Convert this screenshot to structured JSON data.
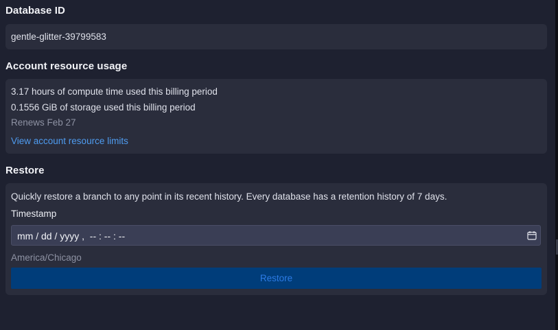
{
  "database": {
    "heading": "Database ID",
    "id": "gentle-glitter-39799583"
  },
  "usage": {
    "heading": "Account resource usage",
    "compute": "3.17 hours of compute time used this billing period",
    "storage": "0.1556 GiB of storage used this billing period",
    "renews": "Renews Feb 27",
    "limits_link": "View account resource limits"
  },
  "restore": {
    "heading": "Restore",
    "description": "Quickly restore a branch to any point in its recent history. Every database has a retention history of 7 days.",
    "timestamp_label": "Timestamp",
    "timestamp_value": "mm / dd / yyyy ,  -- : -- : --",
    "timezone": "America/Chicago",
    "button_label": "Restore",
    "calendar_icon": "calendar-icon"
  },
  "colors": {
    "background": "#1e2130",
    "card": "#2a2d3c",
    "input": "#3a3e55",
    "link": "#4f9cf0",
    "button_bg": "#003d7a",
    "button_text": "#2c7be5"
  }
}
